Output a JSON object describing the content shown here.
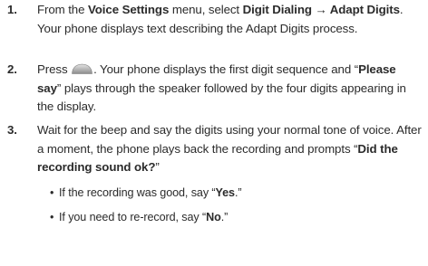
{
  "steps": [
    {
      "num": "1.",
      "a": "From the ",
      "b1": "Voice Settings",
      "c": " menu, select ",
      "b2": "Digit Dialing → Adapt Digits",
      "d": ". Your phone displays text describing the Adapt Digits process."
    },
    {
      "num": "2.",
      "a": "Press ",
      "icon": "ok-key-icon",
      "b": ". Your phone displays the first digit sequence and “",
      "bold": "Please say",
      "c": "” plays through the speaker followed by the four digits appearing in the display."
    },
    {
      "num": "3.",
      "a": "Wait for the beep and say the digits using your normal tone of voice. After a moment, the phone plays back the recording and prompts “",
      "bold": "Did the recording sound ok?",
      "c": "”"
    }
  ],
  "bullets": [
    {
      "dot": "•",
      "a": "If the recording was good, say “",
      "bold": "Yes",
      "c": ".”"
    },
    {
      "dot": "•",
      "a": "If you need to re-record, say “",
      "bold": "No",
      "c": ".”"
    }
  ]
}
